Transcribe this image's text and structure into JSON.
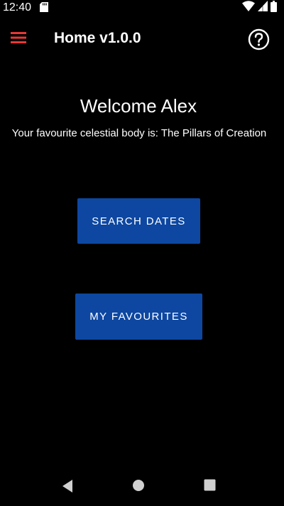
{
  "status_bar": {
    "time": "12:40",
    "icons": [
      "sd-card-icon",
      "wifi-icon",
      "signal-icon",
      "battery-icon"
    ]
  },
  "app_bar": {
    "title": "Home v1.0.0",
    "menu_icon": "hamburger-menu-icon",
    "help_icon": "help-circle-icon",
    "menu_color": "#e53935"
  },
  "main": {
    "welcome": "Welcome Alex",
    "favourite_text": "Your favourite celestial body is: The Pillars of Creation",
    "buttons": {
      "search_dates": "SEARCH DATES",
      "my_favourites": "MY FAVOURITES"
    },
    "button_color": "#0d47a1"
  },
  "nav_bar": {
    "icons": [
      "back-icon",
      "home-icon",
      "recents-icon"
    ]
  }
}
